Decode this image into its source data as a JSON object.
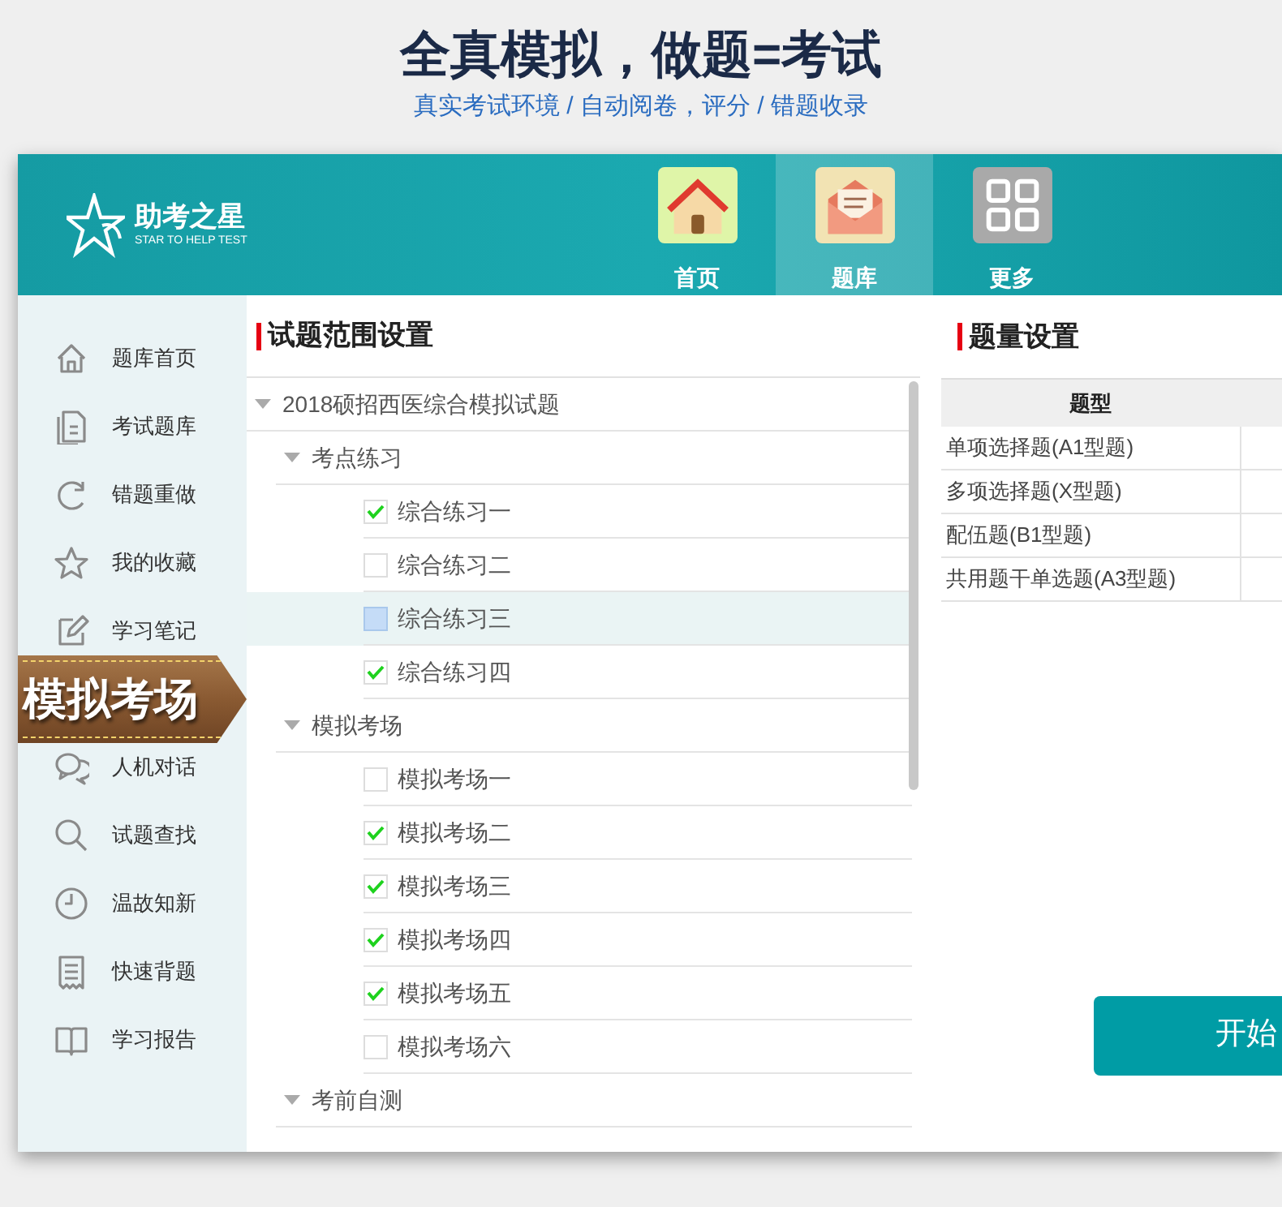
{
  "headline": "全真模拟，做题=考试",
  "subheadline": "真实考试环境 / 自动阅卷，评分 / 错题收录",
  "logo": {
    "name": "助考之星",
    "tagline": "STAR TO HELP TEST"
  },
  "nav": [
    {
      "label": "首页",
      "selected": false
    },
    {
      "label": "题库",
      "selected": true
    },
    {
      "label": "更多",
      "selected": false
    }
  ],
  "sidebar": [
    {
      "label": "题库首页",
      "selected": false
    },
    {
      "label": "考试题库",
      "selected": false
    },
    {
      "label": "错题重做",
      "selected": false
    },
    {
      "label": "我的收藏",
      "selected": false
    },
    {
      "label": "学习笔记",
      "selected": false
    },
    {
      "label": "模拟考场",
      "selected": true
    },
    {
      "label": "人机对话",
      "selected": false
    },
    {
      "label": "试题查找",
      "selected": false
    },
    {
      "label": "温故知新",
      "selected": false
    },
    {
      "label": "快速背题",
      "selected": false
    },
    {
      "label": "学习报告",
      "selected": false
    }
  ],
  "range_panel": {
    "title": "试题范围设置",
    "tree": [
      {
        "label": "2018硕招西医综合模拟试题",
        "expanded": true,
        "children": [
          {
            "label": "考点练习",
            "expanded": true,
            "children": [
              {
                "label": "综合练习一",
                "checked": true,
                "selected": false
              },
              {
                "label": "综合练习二",
                "checked": false,
                "selected": false
              },
              {
                "label": "综合练习三",
                "checked": false,
                "selected": true
              },
              {
                "label": "综合练习四",
                "checked": true,
                "selected": false
              }
            ]
          },
          {
            "label": "模拟考场",
            "expanded": true,
            "children": [
              {
                "label": "模拟考场一",
                "checked": false,
                "selected": false
              },
              {
                "label": "模拟考场二",
                "checked": true,
                "selected": false
              },
              {
                "label": "模拟考场三",
                "checked": true,
                "selected": false
              },
              {
                "label": "模拟考场四",
                "checked": true,
                "selected": false
              },
              {
                "label": "模拟考场五",
                "checked": true,
                "selected": false
              },
              {
                "label": "模拟考场六",
                "checked": false,
                "selected": false
              }
            ]
          },
          {
            "label": "考前自测",
            "expanded": true
          }
        ]
      }
    ]
  },
  "count_panel": {
    "title": "题量设置",
    "columns": [
      "题型"
    ],
    "rows": [
      "单项选择题(A1型题)",
      "多项选择题(X型题)",
      "配伍题(B1型题)",
      "共用题干单选题(A3型题)"
    ]
  },
  "start_button": "开始"
}
